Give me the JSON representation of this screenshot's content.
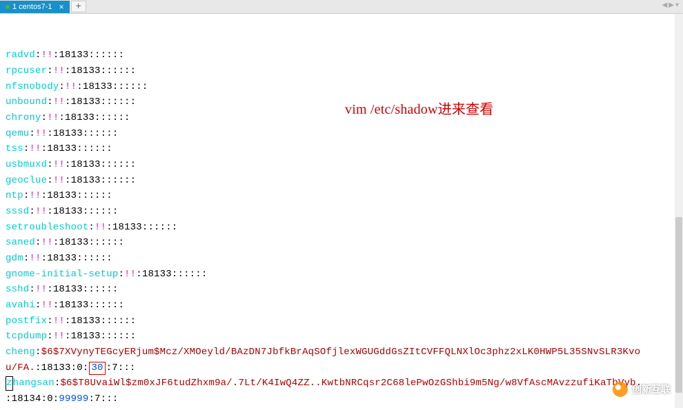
{
  "tab": {
    "label": "1 centos7-1",
    "close": "×",
    "add": "+"
  },
  "nav": {
    "left": "◀",
    "right": "▶",
    "down": "▾"
  },
  "annotation": "vim /etc/shadow进来查看",
  "lines": [
    {
      "user": "radvd",
      "sep1": ":",
      "bang": "!!",
      "sep2": ":",
      "rest": "18133::::::"
    },
    {
      "user": "rpcuser",
      "sep1": ":",
      "bang": "!!",
      "sep2": ":",
      "rest": "18133::::::"
    },
    {
      "user": "nfsnobody",
      "sep1": ":",
      "bang": "!!",
      "sep2": ":",
      "rest": "18133::::::"
    },
    {
      "user": "unbound",
      "sep1": ":",
      "bang": "!!",
      "sep2": ":",
      "rest": "18133::::::"
    },
    {
      "user": "chrony",
      "sep1": ":",
      "bang": "!!",
      "sep2": ":",
      "rest": "18133::::::"
    },
    {
      "user": "qemu",
      "sep1": ":",
      "bang": "!!",
      "sep2": ":",
      "rest": "18133::::::"
    },
    {
      "user": "tss",
      "sep1": ":",
      "bang": "!!",
      "sep2": ":",
      "rest": "18133::::::"
    },
    {
      "user": "usbmuxd",
      "sep1": ":",
      "bang": "!!",
      "sep2": ":",
      "rest": "18133::::::"
    },
    {
      "user": "geoclue",
      "sep1": ":",
      "bang": "!!",
      "sep2": ":",
      "rest": "18133::::::"
    },
    {
      "user": "ntp",
      "sep1": ":",
      "bang": "!!",
      "sep2": ":",
      "rest": "18133::::::"
    },
    {
      "user": "sssd",
      "sep1": ":",
      "bang": "!!",
      "sep2": ":",
      "rest": "18133::::::"
    },
    {
      "user": "setroubleshoot",
      "sep1": ":",
      "bang": "!!",
      "sep2": ":",
      "rest": "18133::::::"
    },
    {
      "user": "saned",
      "sep1": ":",
      "bang": "!!",
      "sep2": ":",
      "rest": "18133::::::"
    },
    {
      "user": "gdm",
      "sep1": ":",
      "bang": "!!",
      "sep2": ":",
      "rest": "18133::::::"
    },
    {
      "user": "gnome-initial-setup",
      "sep1": ":",
      "bang": "!!",
      "sep2": ":",
      "rest": "18133::::::"
    },
    {
      "user": "sshd",
      "sep1": ":",
      "bang": "!!",
      "sep2": ":",
      "rest": "18133::::::"
    },
    {
      "user": "avahi",
      "sep1": ":",
      "bang": "!!",
      "sep2": ":",
      "rest": "18133::::::"
    },
    {
      "user": "postfix",
      "sep1": ":",
      "bang": "!!",
      "sep2": ":",
      "rest": "18133::::::"
    },
    {
      "user": "tcpdump",
      "sep1": ":",
      "bang": "!!",
      "sep2": ":",
      "rest": "18133::::::"
    }
  ],
  "cheng": {
    "user": "cheng",
    "sep": ":",
    "hash": "$6$7XVynyTEGcyERjum$Mcz/XMOeyld/BAzDN7JbfkBrAqSOfjlexWGUGddGsZItCVFFQLNXlOc3phz2xLK0HWP5L35SNvSLR3Kvou/FA.",
    "p1": ":18133:0:",
    "hl": "30",
    "p2": ":",
    "p3": "7:::"
  },
  "zhangsan": {
    "c1": "z",
    "c2": "hangsan",
    "sep": ":",
    "hash": "$6$T8UvaiWl$zm0xJF6tudZhxm9a/.7Lt/K4IwQ4ZZ..KwtbNRCqsr2C68lePwOzGShbi9m5Ng/w8VfAscMAvzzufiKaTbVyb.",
    "p1": ":18134:0:",
    "p2": "99999",
    "p3": ":7:::"
  },
  "watermark": "创新互联"
}
